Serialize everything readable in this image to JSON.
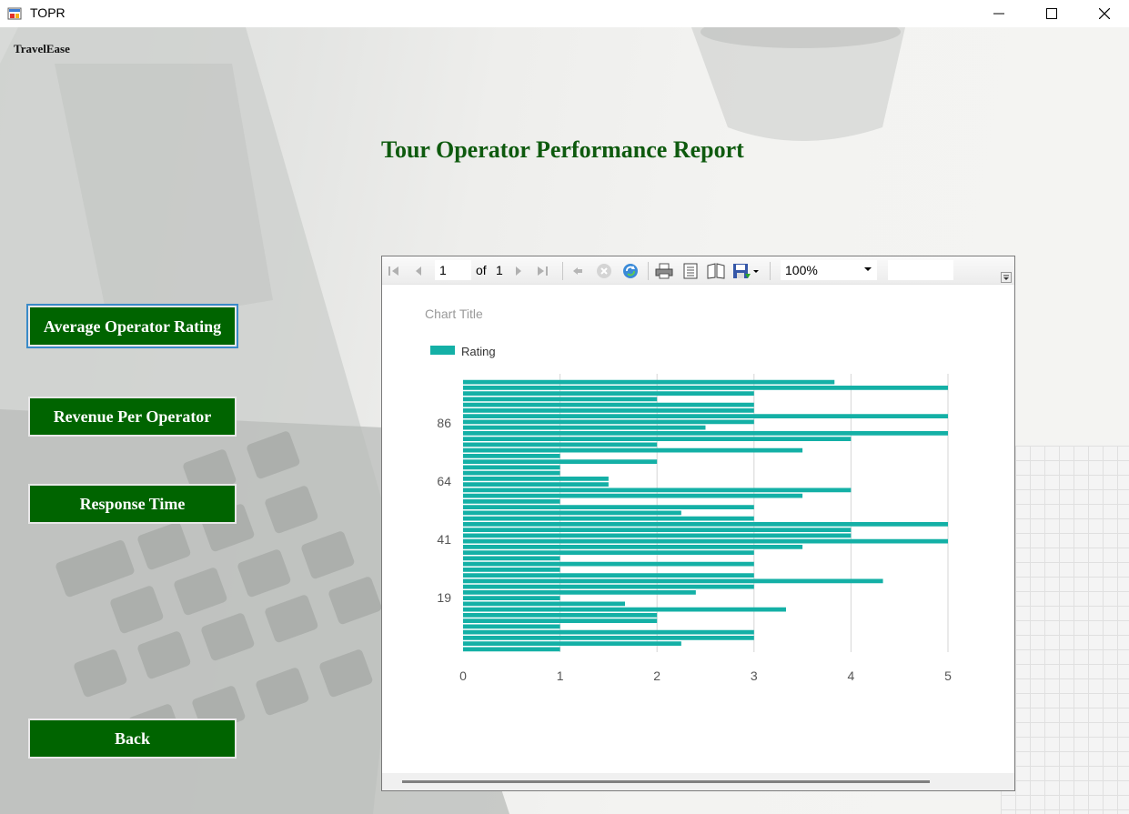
{
  "window": {
    "title": "TOPR"
  },
  "brand": "TravelEase",
  "report_title": "Tour Operator Performance Report",
  "buttons": {
    "avg_rating": "Average Operator Rating",
    "revenue": "Revenue Per Operator",
    "response": "Response Time",
    "back": "Back"
  },
  "toolbar": {
    "page_value": "1",
    "of_label": "of",
    "total_pages": "1",
    "zoom": "100%"
  },
  "colors": {
    "bar": "#14b0a6",
    "button_bg": "#006400",
    "title": "#0e5a0e"
  },
  "chart_data": {
    "type": "bar",
    "orientation": "horizontal",
    "title": "Chart Title",
    "legend": {
      "position": "top-left",
      "entries": [
        "Rating"
      ]
    },
    "series": [
      {
        "name": "Rating",
        "values": [
          1,
          2.25,
          3,
          3,
          1,
          2,
          2,
          3.33,
          1.67,
          1,
          2.4,
          3,
          4.33,
          3,
          1,
          3,
          1,
          3,
          3.5,
          5,
          4,
          4,
          5,
          3,
          2.25,
          3,
          1,
          3.5,
          4,
          1.5,
          1.5,
          1,
          1,
          2,
          1,
          3.5,
          2,
          4,
          5,
          2.5,
          3,
          5,
          3,
          3,
          2,
          3,
          5,
          3.83
        ]
      }
    ],
    "y_tick_labels": [
      "19",
      "41",
      "64",
      "86"
    ],
    "x_ticks": [
      0,
      1,
      2,
      3,
      4,
      5
    ],
    "xlim": [
      0,
      5
    ],
    "grid": "vertical"
  }
}
